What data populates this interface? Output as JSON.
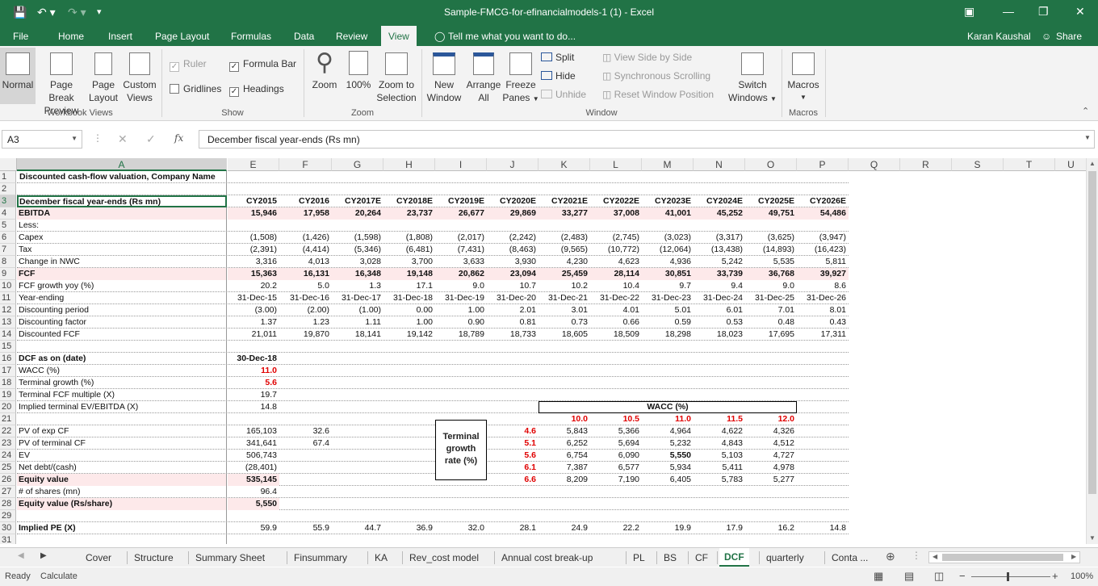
{
  "window": {
    "title": "Sample-FMCG-for-efinancialmodels-1 (1) - Excel",
    "user": "Karan Kaushal",
    "share": "Share"
  },
  "ribbon_tabs": [
    "File",
    "Home",
    "Insert",
    "Page Layout",
    "Formulas",
    "Data",
    "Review",
    "View"
  ],
  "tell_me": "Tell me what you want to do...",
  "ribbon": {
    "workbook_views": {
      "normal": "Normal",
      "page_break_1": "Page Break",
      "page_break_2": "Preview",
      "page_layout_1": "Page",
      "page_layout_2": "Layout",
      "custom_1": "Custom",
      "custom_2": "Views",
      "label": "Workbook Views"
    },
    "show": {
      "ruler": "Ruler",
      "formula_bar": "Formula Bar",
      "gridlines": "Gridlines",
      "headings": "Headings",
      "label": "Show"
    },
    "zoom": {
      "zoom": "Zoom",
      "hundred": "100%",
      "zoom_sel_1": "Zoom to",
      "zoom_sel_2": "Selection",
      "label": "Zoom"
    },
    "window": {
      "new_1": "New",
      "new_2": "Window",
      "arrange_1": "Arrange",
      "arrange_2": "All",
      "freeze_1": "Freeze",
      "freeze_2": "Panes",
      "split": "Split",
      "hide": "Hide",
      "unhide": "Unhide",
      "side_by_side": "View Side by Side",
      "sync_scroll": "Synchronous Scrolling",
      "reset_pos": "Reset Window Position",
      "switch_1": "Switch",
      "switch_2": "Windows",
      "label": "Window"
    },
    "macros": {
      "macros": "Macros",
      "label": "Macros"
    }
  },
  "formula_bar": {
    "name_box": "A3",
    "fx": "fx",
    "content": "December fiscal year-ends (Rs mn)"
  },
  "columns": [
    "A",
    "E",
    "F",
    "G",
    "H",
    "I",
    "J",
    "K",
    "L",
    "M",
    "N",
    "O",
    "P",
    "Q",
    "R",
    "S",
    "T",
    "U"
  ],
  "sheet": {
    "r1": "Discounted cash-flow valuation, Company Name",
    "r3_label": "December fiscal year-ends (Rs mn)",
    "years": [
      "CY2015",
      "CY2016",
      "CY2017E",
      "CY2018E",
      "CY2019E",
      "CY2020E",
      "CY2021E",
      "CY2022E",
      "CY2023E",
      "CY2024E",
      "CY2025E",
      "CY2026E"
    ],
    "rows": [
      {
        "label": "EBITDA",
        "bold": true,
        "pink": true,
        "values": [
          "15,946",
          "17,958",
          "20,264",
          "23,737",
          "26,677",
          "29,869",
          "33,277",
          "37,008",
          "41,001",
          "45,252",
          "49,751",
          "54,486"
        ]
      },
      {
        "label": "Less:",
        "values": []
      },
      {
        "label": "Capex",
        "values": [
          "(1,508)",
          "(1,426)",
          "(1,598)",
          "(1,808)",
          "(2,017)",
          "(2,242)",
          "(2,483)",
          "(2,745)",
          "(3,023)",
          "(3,317)",
          "(3,625)",
          "(3,947)"
        ]
      },
      {
        "label": "Tax",
        "values": [
          "(2,391)",
          "(4,414)",
          "(5,346)",
          "(6,481)",
          "(7,431)",
          "(8,463)",
          "(9,565)",
          "(10,772)",
          "(12,064)",
          "(13,438)",
          "(14,893)",
          "(16,423)"
        ]
      },
      {
        "label": "Change in NWC",
        "values": [
          "3,316",
          "4,013",
          "3,028",
          "3,700",
          "3,633",
          "3,930",
          "4,230",
          "4,623",
          "4,936",
          "5,242",
          "5,535",
          "5,811"
        ]
      },
      {
        "label": "FCF",
        "bold": true,
        "pink": true,
        "values": [
          "15,363",
          "16,131",
          "16,348",
          "19,148",
          "20,862",
          "23,094",
          "25,459",
          "28,114",
          "30,851",
          "33,739",
          "36,768",
          "39,927"
        ]
      },
      {
        "label": "FCF growth yoy (%)",
        "values": [
          "20.2",
          "5.0",
          "1.3",
          "17.1",
          "9.0",
          "10.7",
          "10.2",
          "10.4",
          "9.7",
          "9.4",
          "9.0",
          "8.6"
        ]
      },
      {
        "label": "Year-ending",
        "values": [
          "31-Dec-15",
          "31-Dec-16",
          "31-Dec-17",
          "31-Dec-18",
          "31-Dec-19",
          "31-Dec-20",
          "31-Dec-21",
          "31-Dec-22",
          "31-Dec-23",
          "31-Dec-24",
          "31-Dec-25",
          "31-Dec-26"
        ]
      },
      {
        "label": "Discounting period",
        "values": [
          "(3.00)",
          "(2.00)",
          "(1.00)",
          "0.00",
          "1.00",
          "2.01",
          "3.01",
          "4.01",
          "5.01",
          "6.01",
          "7.01",
          "8.01"
        ]
      },
      {
        "label": "Discounting factor",
        "values": [
          "1.37",
          "1.23",
          "1.11",
          "1.00",
          "0.90",
          "0.81",
          "0.73",
          "0.66",
          "0.59",
          "0.53",
          "0.48",
          "0.43"
        ]
      },
      {
        "label": "Discounted FCF",
        "values": [
          "21,011",
          "19,870",
          "18,141",
          "19,142",
          "18,789",
          "18,733",
          "18,605",
          "18,509",
          "18,298",
          "18,023",
          "17,695",
          "17,311"
        ]
      }
    ],
    "dcf": [
      {
        "label": "DCF as on (date)",
        "bold": true,
        "value": "30-Dec-18",
        "vbold": true
      },
      {
        "label": "WACC (%)",
        "value": "11.0",
        "red": true
      },
      {
        "label": "Terminal growth (%)",
        "value": "5.6",
        "red": true
      },
      {
        "label": "Terminal FCF multiple (X)",
        "value": "19.7"
      },
      {
        "label": "Implied terminal EV/EBITDA (X)",
        "value": "14.8"
      }
    ],
    "valuation": [
      {
        "label": "PV of exp CF",
        "value": "165,103",
        "pct": "32.6"
      },
      {
        "label": "PV of terminal CF",
        "value": "341,641",
        "pct": "67.4"
      },
      {
        "label": "EV",
        "value": "506,743"
      },
      {
        "label": "Net debt/(cash)",
        "value": "(28,401)"
      },
      {
        "label": "Equity value",
        "value": "535,145",
        "bold": true,
        "pink": true
      },
      {
        "label": "# of shares (mn)",
        "value": "96.4"
      },
      {
        "label": "Equity value (Rs/share)",
        "value": "5,550",
        "bold": true,
        "pink": true
      }
    ],
    "implied_pe": {
      "label": "Implied PE (X)",
      "values": [
        "59.9",
        "55.9",
        "44.7",
        "36.9",
        "32.0",
        "28.1",
        "24.9",
        "22.2",
        "19.9",
        "17.9",
        "16.2",
        "14.8"
      ]
    },
    "sensitivity": {
      "title": "WACC (%)",
      "side_1": "Terminal",
      "side_2": "growth",
      "side_3": "rate (%)",
      "wacc": [
        "10.0",
        "10.5",
        "11.0",
        "11.5",
        "12.0"
      ],
      "growth": [
        "4.6",
        "5.1",
        "5.6",
        "6.1",
        "6.6"
      ],
      "matrix": [
        [
          "5,843",
          "5,366",
          "4,964",
          "4,622",
          "4,326"
        ],
        [
          "6,252",
          "5,694",
          "5,232",
          "4,843",
          "4,512"
        ],
        [
          "6,754",
          "6,090",
          "5,550",
          "5,103",
          "4,727"
        ],
        [
          "7,387",
          "6,577",
          "5,934",
          "5,411",
          "4,978"
        ],
        [
          "8,209",
          "7,190",
          "6,405",
          "5,783",
          "5,277"
        ]
      ]
    }
  },
  "sheet_tabs": [
    "Cover",
    "Structure",
    "Summary Sheet",
    "Finsummary",
    "KA",
    "Rev_cost model",
    "Annual cost break-up",
    "PL",
    "BS",
    "CF",
    "DCF",
    "quarterly",
    "Conta ..."
  ],
  "active_tab": "DCF",
  "status": {
    "ready": "Ready",
    "calculate": "Calculate",
    "zoom": "100%"
  }
}
